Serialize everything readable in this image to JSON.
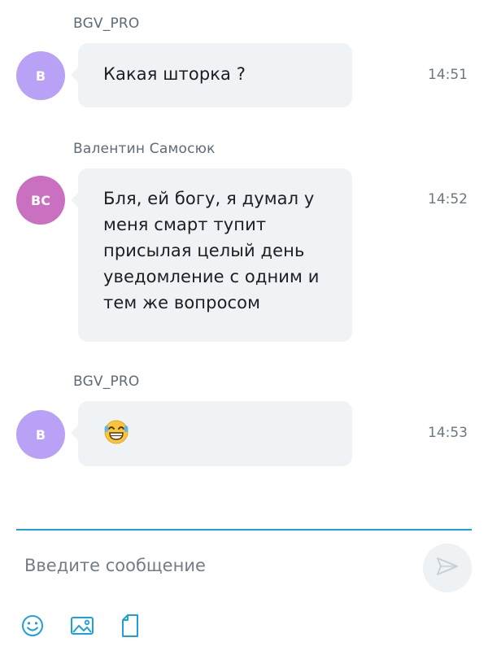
{
  "messages": [
    {
      "sender": "BGV_PRO",
      "initials": "B",
      "avatar_color": "#b9a1f5",
      "text": "Какая шторка ?",
      "time": "14:51"
    },
    {
      "sender": "Валентин Самосюк",
      "initials": "BC",
      "avatar_color": "#c970c0",
      "text": "Бля, ей богу, я думал у\nменя смарт тупит\nприсылая целый день\nуведомление с одним и\nтем же вопросом",
      "time": "14:52"
    },
    {
      "sender": "BGV_PRO",
      "initials": "B",
      "avatar_color": "#b9a1f5",
      "emoji": "grinning-face-with-tears-emoji",
      "time": "14:53"
    }
  ],
  "composer": {
    "placeholder": "Введите сообщение",
    "value": "",
    "accent_color": "#1ea0db",
    "send_icon": "send-icon",
    "tool_icons": [
      "emoji-icon",
      "image-icon",
      "file-icon"
    ]
  }
}
